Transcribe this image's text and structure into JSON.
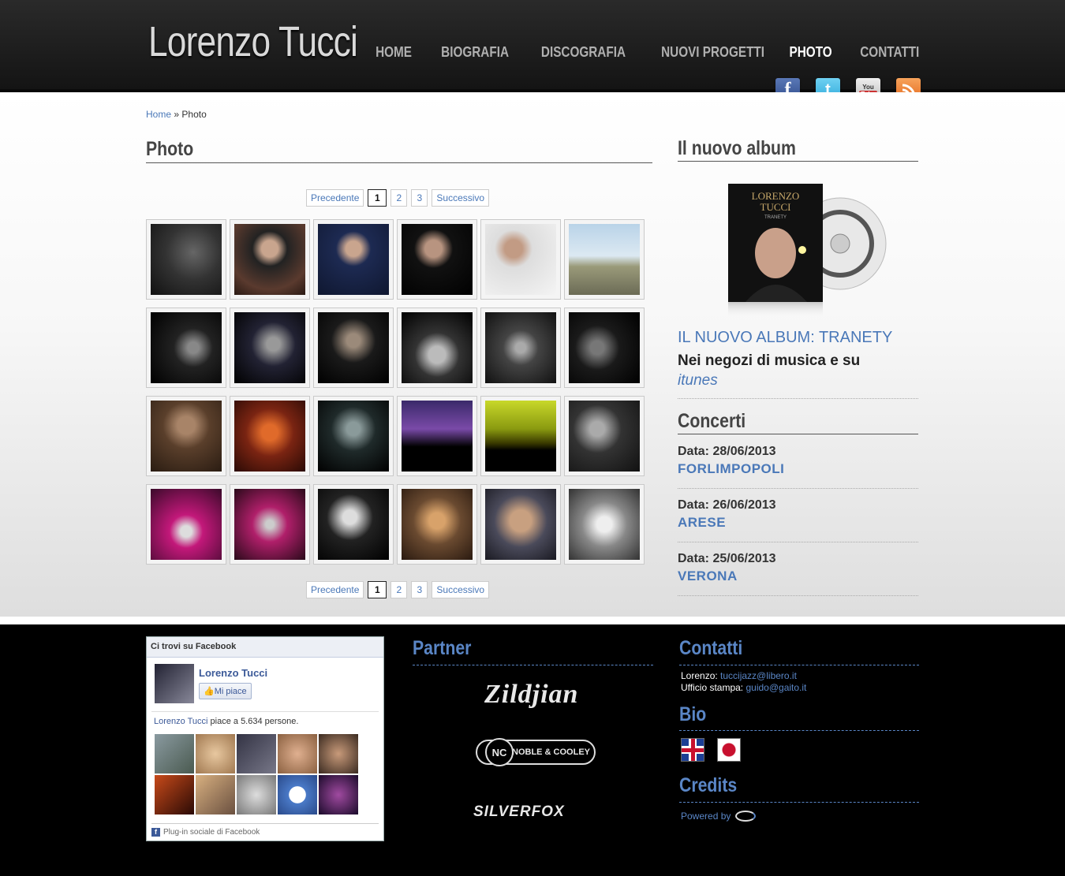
{
  "header": {
    "logo": "Lorenzo Tucci",
    "nav": [
      "HOME",
      "BIOGRAFIA",
      "DISCOGRAFIA",
      "NUOVI PROGETTI",
      "PHOTO",
      "CONTATTI"
    ],
    "active": "PHOTO",
    "social": [
      "facebook-icon",
      "twitter-icon",
      "youtube-icon",
      "rss-icon"
    ],
    "youtube_text": [
      "You",
      "Tube"
    ]
  },
  "breadcrumb": {
    "home": "Home",
    "sep": "»",
    "current": "Photo"
  },
  "gallery": {
    "title": "Photo",
    "pager": {
      "prev": "Precedente",
      "pages": [
        "1",
        "2",
        "3"
      ],
      "current": "1",
      "next": "Successivo"
    }
  },
  "sidebar": {
    "album_title": "Il nuovo album",
    "album_link": "IL NUOVO ALBUM: TRANETY",
    "album_text": "Nei negozi di musica e su",
    "album_itunes": "itunes",
    "album_cover_text": [
      "LORENZO",
      "TUCCI",
      "TRANETY"
    ],
    "concerti_title": "Concerti",
    "concerts": [
      {
        "date": "Data: 28/06/2013",
        "city": "FORLIMPOPOLI"
      },
      {
        "date": "Data: 26/06/2013",
        "city": "ARESE"
      },
      {
        "date": "Data: 25/06/2013",
        "city": "VERONA"
      }
    ]
  },
  "footer": {
    "facebook": {
      "header": "Ci trovi su Facebook",
      "name": "Lorenzo Tucci",
      "like": "Mi piace",
      "count_name": "Lorenzo Tucci",
      "count_text": " piace a 5.634 persone.",
      "plugin": "Plug-in sociale di Facebook"
    },
    "partner_title": "Partner",
    "partners": {
      "zildjian": "Zildjian",
      "noble_mono": "NC",
      "noble": "NOBLE & COOLEY",
      "silverfox": "SILVERFOX"
    },
    "contatti_title": "Contatti",
    "contatti": {
      "lorenzo_label": "Lorenzo: ",
      "lorenzo_email": "tuccijazz@libero.it",
      "stampa_label": "Ufficio stampa: ",
      "stampa_email": "guido@gaito.it"
    },
    "bio_title": "Bio",
    "credits_title": "Credits",
    "powered": "Powered by"
  }
}
